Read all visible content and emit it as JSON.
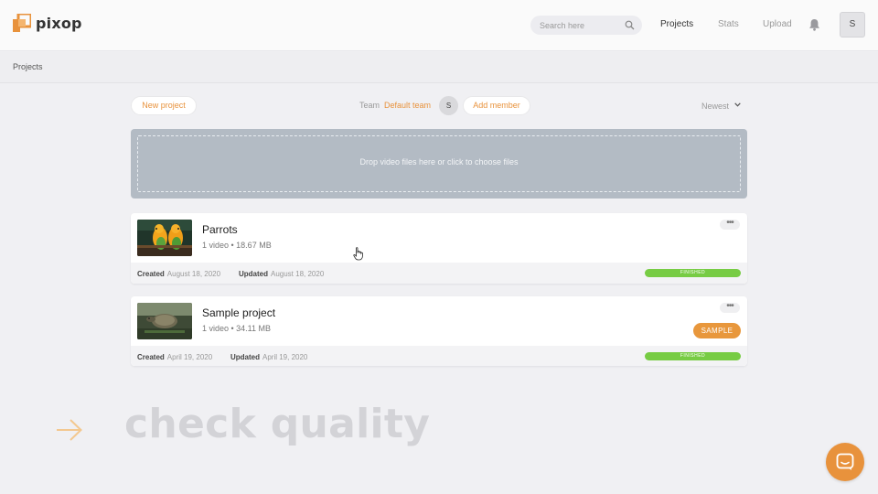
{
  "app": {
    "logo_text": "pixop",
    "brand_color": "#e8923c"
  },
  "header": {
    "search_placeholder": "Search here",
    "nav": [
      {
        "label": "Projects",
        "active": true
      },
      {
        "label": "Stats",
        "active": false
      },
      {
        "label": "Upload",
        "active": false
      }
    ],
    "icons": [
      "search-icon",
      "bell-icon"
    ],
    "user_initial": "S"
  },
  "breadcrumb": "Projects",
  "toolbar": {
    "new_project_label": "New project",
    "team_label": "Team",
    "team_name": "Default team",
    "team_member_initial": "S",
    "add_member_label": "Add member",
    "sort_label": "Newest"
  },
  "dropzone": {
    "text": "Drop video files here or click to choose files"
  },
  "projects": [
    {
      "title": "Parrots",
      "meta": "1 video • 18.67 MB",
      "created_label": "Created",
      "created_date": "August 18, 2020",
      "updated_label": "Updated",
      "updated_date": "August 18, 2020",
      "status": "FINISHED",
      "status_color": "#77cc44",
      "badge": "",
      "thumb": "parrots-thumbnail"
    },
    {
      "title": "Sample project",
      "meta": "1 video • 34.11 MB",
      "created_label": "Created",
      "created_date": "April 19, 2020",
      "updated_label": "Updated",
      "updated_date": "April 19, 2020",
      "status": "FINISHED",
      "status_color": "#77cc44",
      "badge": "SAMPLE",
      "badge_color": "#e8973c",
      "thumb": "turtle-thumbnail"
    }
  ],
  "overlay": {
    "text": "check quality"
  }
}
